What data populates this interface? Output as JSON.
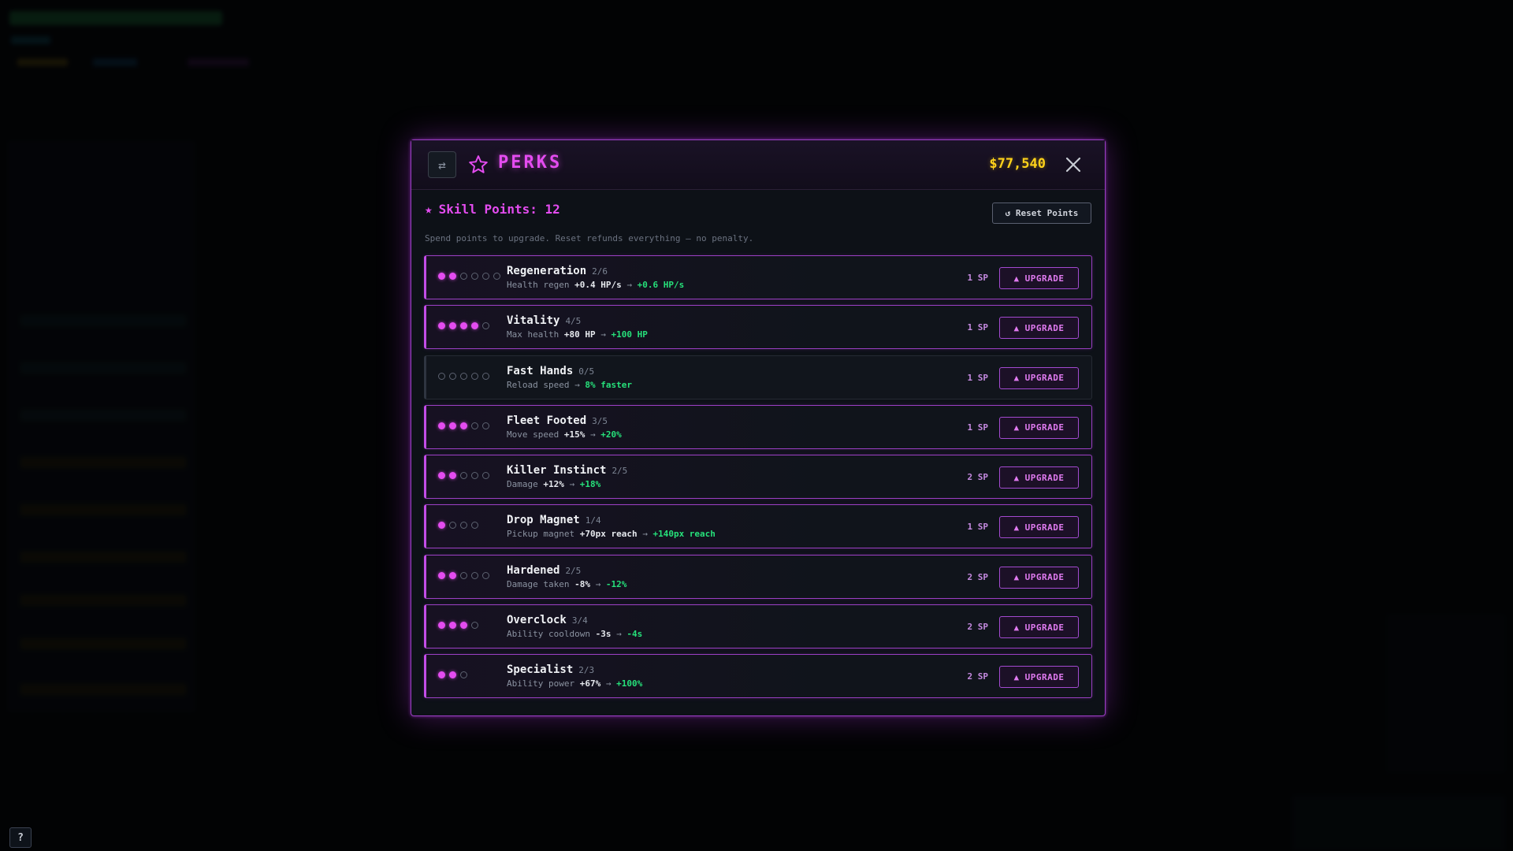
{
  "modal": {
    "title": "PERKS",
    "money": "$77,540",
    "swap_icon": "⇄",
    "skill_points_label": "Skill Points: 12",
    "reset_label": "↺ Reset Points",
    "hint": "Spend points to upgrade. Reset refunds everything — no penalty.",
    "upgrade_label": "▲ UPGRADE"
  },
  "perks": [
    {
      "name": "Regeneration",
      "level": "2/6",
      "filled": 2,
      "max": 6,
      "desc_prefix": "Health regen",
      "current": "+0.4 HP/s",
      "arrow": "→",
      "next": "+0.6 HP/s",
      "cost": "1 SP"
    },
    {
      "name": "Vitality",
      "level": "4/5",
      "filled": 4,
      "max": 5,
      "desc_prefix": "Max health",
      "current": "+80 HP",
      "arrow": "→",
      "next": "+100 HP",
      "cost": "1 SP"
    },
    {
      "name": "Fast Hands",
      "level": "0/5",
      "filled": 0,
      "max": 5,
      "desc_prefix": "Reload speed",
      "current": "",
      "arrow": "→",
      "next": "8% faster",
      "cost": "1 SP"
    },
    {
      "name": "Fleet Footed",
      "level": "3/5",
      "filled": 3,
      "max": 5,
      "desc_prefix": "Move speed",
      "current": "+15%",
      "arrow": "→",
      "next": "+20%",
      "cost": "1 SP"
    },
    {
      "name": "Killer Instinct",
      "level": "2/5",
      "filled": 2,
      "max": 5,
      "desc_prefix": "Damage",
      "current": "+12%",
      "arrow": "→",
      "next": "+18%",
      "cost": "2 SP"
    },
    {
      "name": "Drop Magnet",
      "level": "1/4",
      "filled": 1,
      "max": 4,
      "desc_prefix": "Pickup magnet",
      "current": "+70px reach",
      "arrow": "→",
      "next": "+140px reach",
      "cost": "1 SP"
    },
    {
      "name": "Hardened",
      "level": "2/5",
      "filled": 2,
      "max": 5,
      "desc_prefix": "Damage taken",
      "current": "-8%",
      "arrow": "→",
      "next": "-12%",
      "cost": "2 SP"
    },
    {
      "name": "Overclock",
      "level": "3/4",
      "filled": 3,
      "max": 4,
      "desc_prefix": "Ability cooldown",
      "current": "-3s",
      "arrow": "→",
      "next": "-4s",
      "cost": "2 SP"
    },
    {
      "name": "Specialist",
      "level": "2/3",
      "filled": 2,
      "max": 3,
      "desc_prefix": "Ability power",
      "current": "+67%",
      "arrow": "→",
      "next": "+100%",
      "cost": "2 SP"
    }
  ],
  "help_label": "?",
  "colors": {
    "accent": "#e44cf0",
    "money": "#ffd21a",
    "next_value": "#26e07a"
  }
}
